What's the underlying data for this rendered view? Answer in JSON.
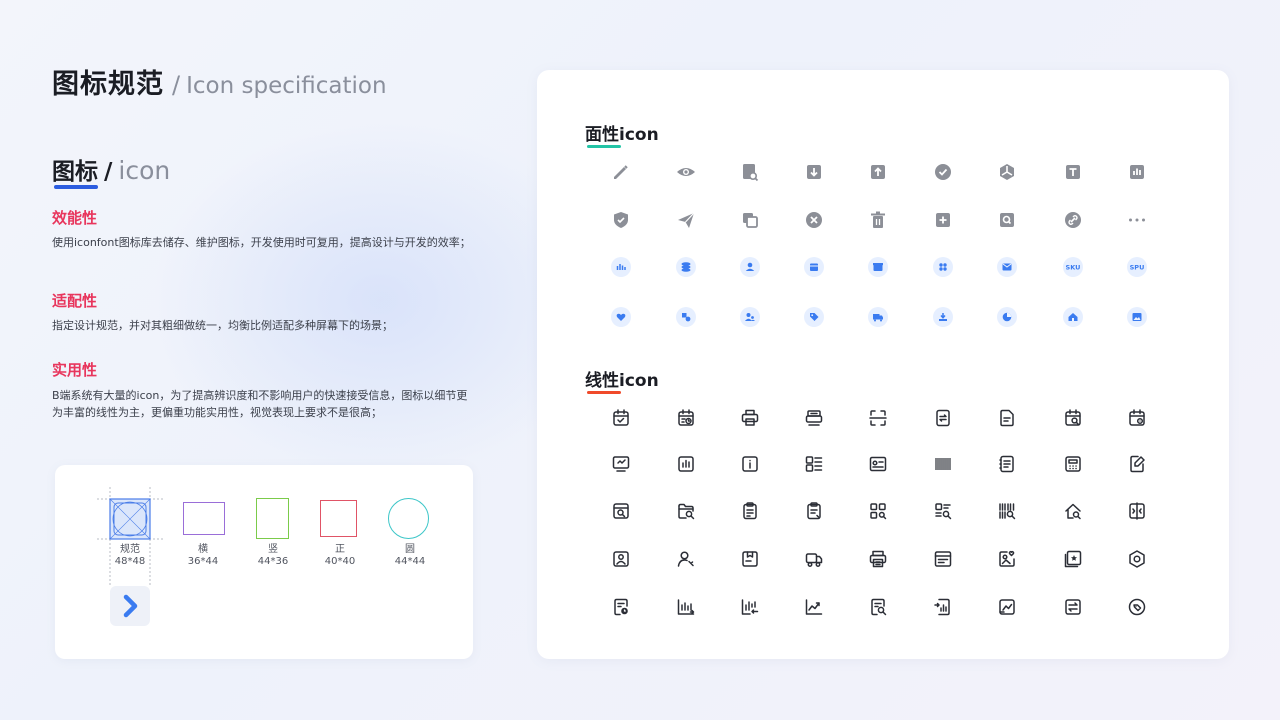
{
  "title": {
    "cn": "图标规范",
    "sep": "/",
    "en": "Icon specification"
  },
  "subtitle": {
    "cn": "图标",
    "slash": "/",
    "en": "icon"
  },
  "sections": [
    {
      "heading": "效能性",
      "text": "使用iconfont图标库去储存、维护图标，开发使用时可复用，提高设计与开发的效率；"
    },
    {
      "heading": "适配性",
      "text": "指定设计规范，并对其粗细做统一，均衡比例适配多种屏幕下的场景；"
    },
    {
      "heading": "实用性",
      "text": "B端系统有大量的icon，为了提高辨识度和不影响用户的快速接受信息，图标以细节更为丰富的线性为主，更偏重功能实用性，视觉表现上要求不是很高；"
    }
  ],
  "shapes": [
    {
      "name": "规范",
      "size": "48*48"
    },
    {
      "name": "横",
      "size": "36*44"
    },
    {
      "name": "竖",
      "size": "44*36"
    },
    {
      "name": "正",
      "size": "40*40"
    },
    {
      "name": "圆",
      "size": "44*44"
    }
  ],
  "colors": {
    "accent_red": "#e8365d",
    "blue": "#2c5de0",
    "icon_blue": "#3a7bf0",
    "icon_gray": "#8c8f97",
    "teal": "#23c4a6",
    "underline_red": "#f04a2a"
  },
  "card": {
    "solid_heading": {
      "cn": "面性",
      "en": "icon"
    },
    "line_heading": {
      "cn": "线性",
      "en": "icon"
    },
    "gray_icons": [
      "edit-icon",
      "eye-icon",
      "doc-search-icon",
      "download-icon",
      "upload-icon",
      "check-icon",
      "pie-icon",
      "text-icon",
      "bar-chart-icon",
      "shield-icon",
      "send-icon",
      "copy-icon",
      "close-icon",
      "trash-icon",
      "plus-icon",
      "search-icon",
      "link-icon",
      "more-icon"
    ],
    "blue_icons": [
      "chart-icon",
      "layers-icon",
      "user-icon",
      "calendar-icon",
      "store-icon",
      "grid-icon",
      "mail-icon",
      "sku-icon",
      "spu-icon",
      "heart-icon",
      "shapes-icon",
      "users-icon",
      "tag-icon",
      "truck-icon",
      "download-tray-icon",
      "pie-chart-icon",
      "home-icon",
      "image-icon"
    ],
    "badge_sku": "SKU",
    "badge_spu": "SPU",
    "line_icons": [
      "calendar-tag-icon",
      "calendar-time-icon",
      "printer-icon",
      "printer-alt-icon",
      "scan-icon",
      "transfer-icon",
      "note-icon",
      "calendar-search-icon",
      "calendar-settings-icon",
      "monitor-icon",
      "waveform-icon",
      "info-icon",
      "list-icon",
      "card-icon",
      "barcode-icon",
      "document-icon",
      "calculator-icon",
      "edit-note-icon",
      "box-search-icon",
      "folder-search-icon",
      "clipboard-icon",
      "clipboard-alt-icon",
      "qr-icon",
      "list-search-icon",
      "barcode-search-icon",
      "house-check-icon",
      "split-icon",
      "picture-icon",
      "user-key-icon",
      "map-icon",
      "truck-outline-icon",
      "printer-outline-icon",
      "browser-icon",
      "picture-heart-icon",
      "star-frame-icon",
      "hexagon-icon",
      "file-clock-icon",
      "chart-up-icon",
      "chart-down-icon",
      "trend-chart-icon",
      "doc-search-outline-icon",
      "chart-import-icon",
      "line-chart-icon",
      "exchange-icon",
      "tag-outline-icon"
    ]
  }
}
